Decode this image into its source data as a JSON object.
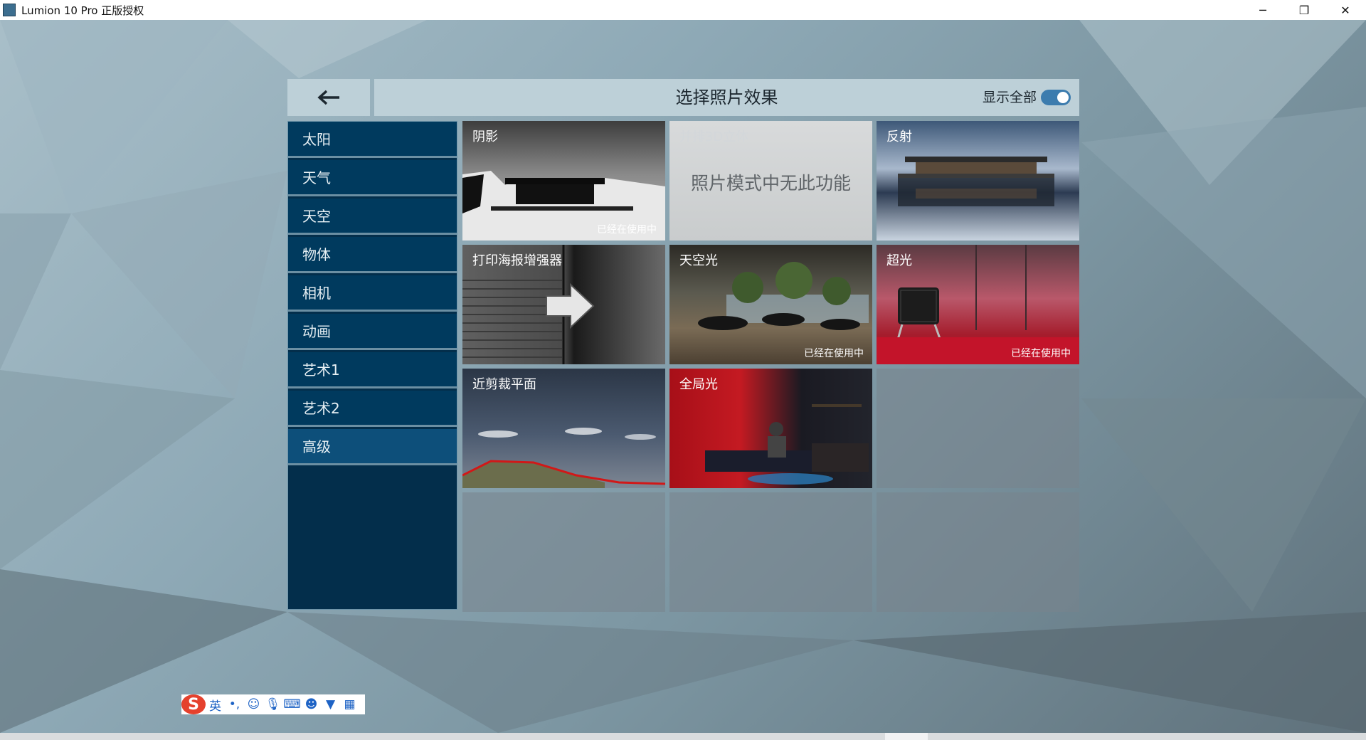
{
  "window": {
    "title": "Lumion 10 Pro 正版授权",
    "controls": [
      "minimize",
      "restore",
      "close"
    ]
  },
  "header": {
    "title": "选择照片效果",
    "show_all_label": "显示全部",
    "show_all_on": true
  },
  "sidebar": {
    "items": [
      {
        "label": "太阳"
      },
      {
        "label": "天气"
      },
      {
        "label": "天空"
      },
      {
        "label": "物体"
      },
      {
        "label": "相机"
      },
      {
        "label": "动画"
      },
      {
        "label": "艺术1"
      },
      {
        "label": "艺术2"
      },
      {
        "label": "高级",
        "active": true
      }
    ]
  },
  "effects": [
    {
      "label": "阴影",
      "status": "已经在使用中"
    },
    {
      "label": "并排3D立体",
      "disabled_message": "照片模式中无此功能"
    },
    {
      "label": "反射"
    },
    {
      "label": "打印海报增强器"
    },
    {
      "label": "天空光",
      "status": "已经在使用中"
    },
    {
      "label": "超光",
      "status": "已经在使用中"
    },
    {
      "label": "近剪裁平面"
    },
    {
      "label": "全局光"
    }
  ],
  "ime": {
    "language": "英",
    "punct": "•,",
    "icons": [
      "smiley-icon",
      "microphone-icon",
      "keyboard-icon",
      "user-icon",
      "shirt-icon",
      "grid-icon"
    ]
  }
}
